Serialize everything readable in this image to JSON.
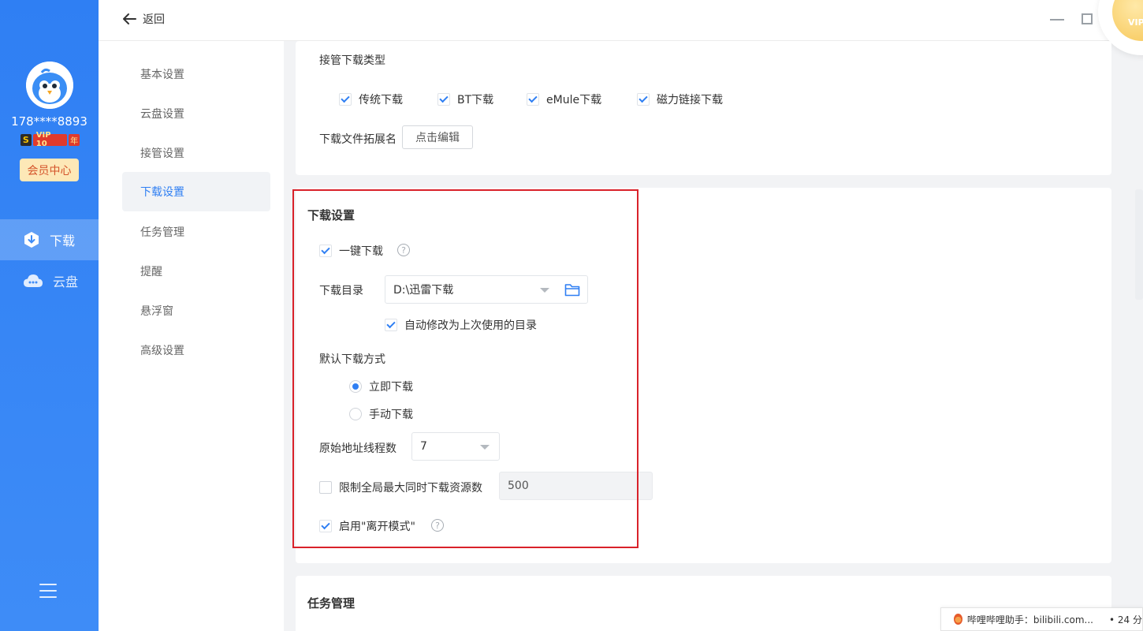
{
  "sidebar": {
    "phone": "178****8893",
    "vip": {
      "s": "S",
      "label": "VIP 10",
      "year": "年"
    },
    "member_center": "会员中心",
    "nav": [
      {
        "label": "下载",
        "icon": "download-shield-icon"
      },
      {
        "label": "云盘",
        "icon": "cloud-icon"
      }
    ]
  },
  "topbar": {
    "back": "返回",
    "vip_corner": "VIP"
  },
  "subnav": [
    "基本设置",
    "云盘设置",
    "接管设置",
    "下载设置",
    "任务管理",
    "提醒",
    "悬浮窗",
    "高级设置"
  ],
  "takeover": {
    "types_title": "接管下载类型",
    "types": [
      {
        "label": "传统下载",
        "checked": true
      },
      {
        "label": "BT下载",
        "checked": true
      },
      {
        "label": "eMule下载",
        "checked": true
      },
      {
        "label": "磁力链接下载",
        "checked": true
      }
    ],
    "ext_label": "下载文件拓展名",
    "ext_button": "点击编辑"
  },
  "download": {
    "title": "下载设置",
    "one_click": "一键下载",
    "help": "?",
    "dir_label": "下载目录",
    "dir_value": "D:\\迅雷下载",
    "auto_dir": "自动修改为上次使用的目录",
    "mode_title": "默认下载方式",
    "mode_now": "立即下载",
    "mode_manual": "手动下载",
    "threads_label": "原始地址线程数",
    "threads_value": "7",
    "limit_label": "限制全局最大同时下载资源数",
    "limit_value": "500",
    "away_label": "启用\"离开模式\""
  },
  "task": {
    "title": "任务管理"
  },
  "toast": {
    "text": "哔哩哔哩助手：bilibili.com...",
    "time": "• 24 分"
  },
  "colors": {
    "accent": "#2f7ff3",
    "sidebar": "#3e8cf7",
    "highlight": "#d9222a"
  }
}
